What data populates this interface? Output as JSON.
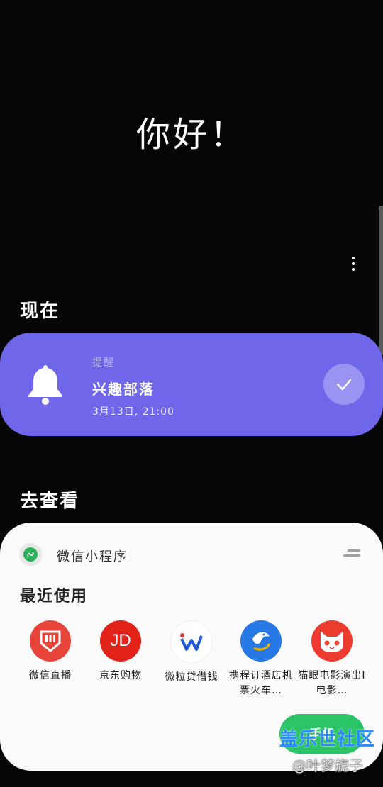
{
  "greeting": "你好！",
  "sections": {
    "now": "现在",
    "go_look": "去查看"
  },
  "reminder": {
    "type": "提醒",
    "title": "兴趣部落",
    "time": "3月13日, 21:00"
  },
  "mini_program": {
    "title": "微信小程序",
    "recent_label": "最近使用",
    "apps": [
      {
        "label": "微信直播",
        "icon": "wechat-live-icon",
        "color": "#e8443a"
      },
      {
        "label": "京东购物",
        "icon": "jd-icon",
        "color": "#e2231a"
      },
      {
        "label": "微粒贷借钱",
        "icon": "weilidai-icon",
        "color": "#ffffff"
      },
      {
        "label": "携程订酒店机票火车…",
        "icon": "ctrip-icon",
        "color": "#2577e3"
      },
      {
        "label": "猫眼电影演出I电影…",
        "icon": "maoyan-icon",
        "color": "#ee3b2f"
      }
    ],
    "fab_label": "手机"
  },
  "watermark": {
    "site": "盖乐世社区",
    "user": "@叶梦旎子"
  },
  "colors": {
    "accent": "#7066ea",
    "background": "#060606",
    "panel": "#fafafa"
  }
}
